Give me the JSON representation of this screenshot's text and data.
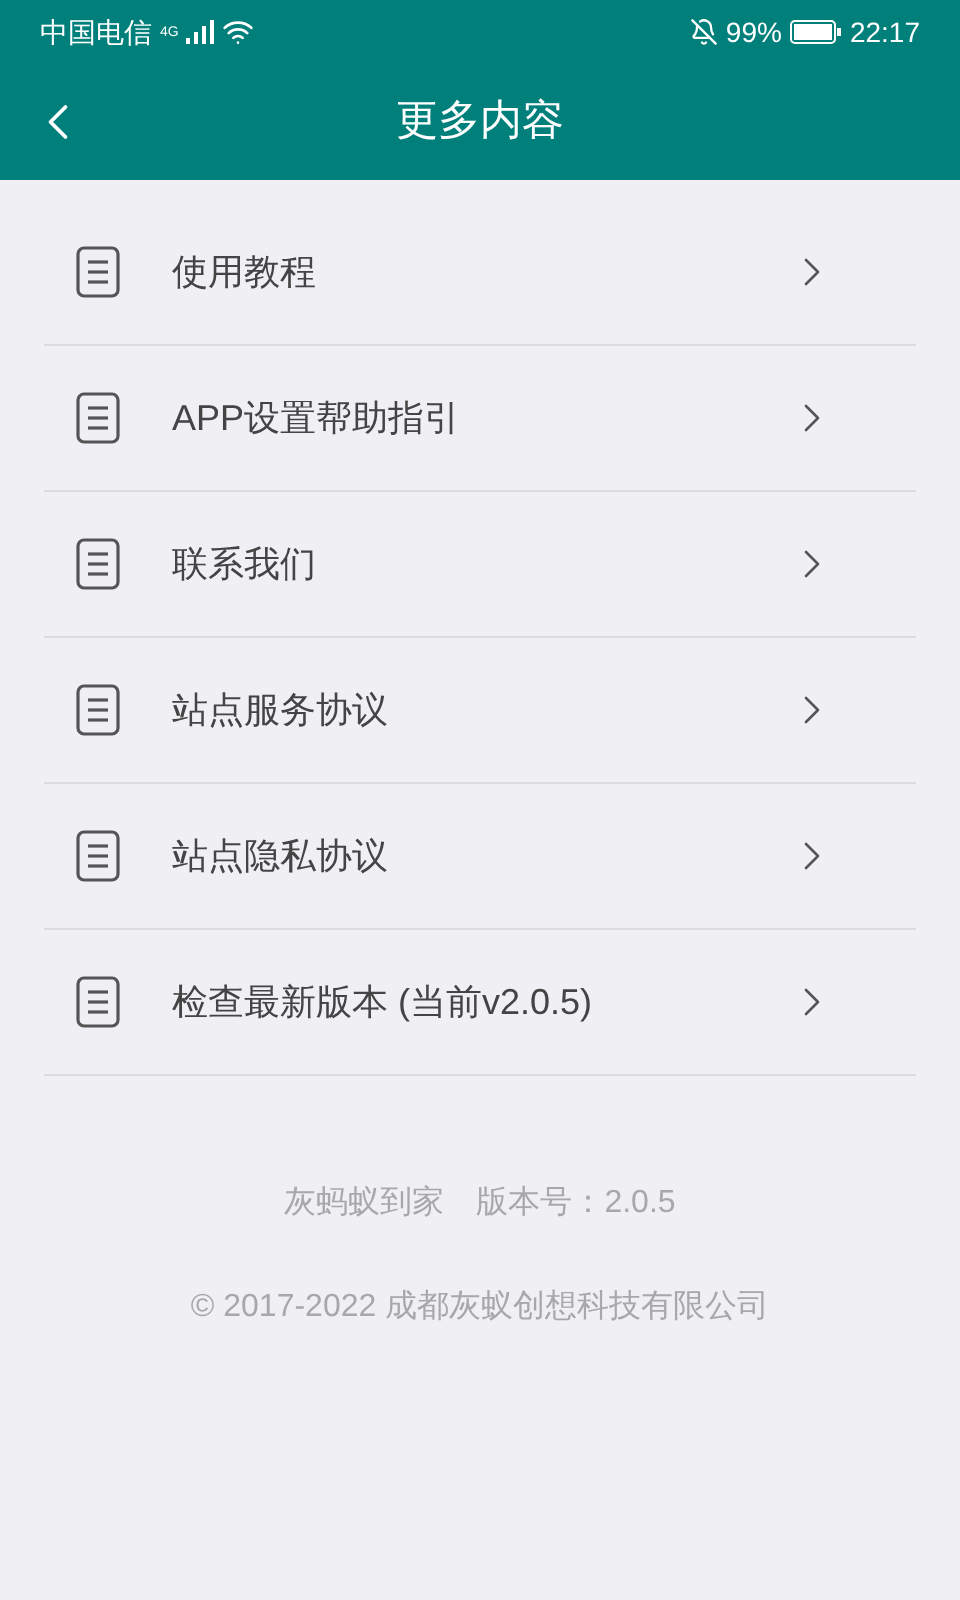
{
  "status_bar": {
    "carrier": "中国电信",
    "network": "4G",
    "battery": "99%",
    "time": "22:17"
  },
  "header": {
    "title": "更多内容"
  },
  "items": [
    {
      "label": "使用教程"
    },
    {
      "label": "APP设置帮助指引"
    },
    {
      "label": "联系我们"
    },
    {
      "label": "站点服务协议"
    },
    {
      "label": "站点隐私协议"
    },
    {
      "label": "检查最新版本 (当前v2.0.5)"
    }
  ],
  "footer": {
    "app_name": "灰蚂蚁到家",
    "version": "版本号：2.0.5",
    "copyright": "© 2017-2022 成都灰蚁创想科技有限公司"
  }
}
